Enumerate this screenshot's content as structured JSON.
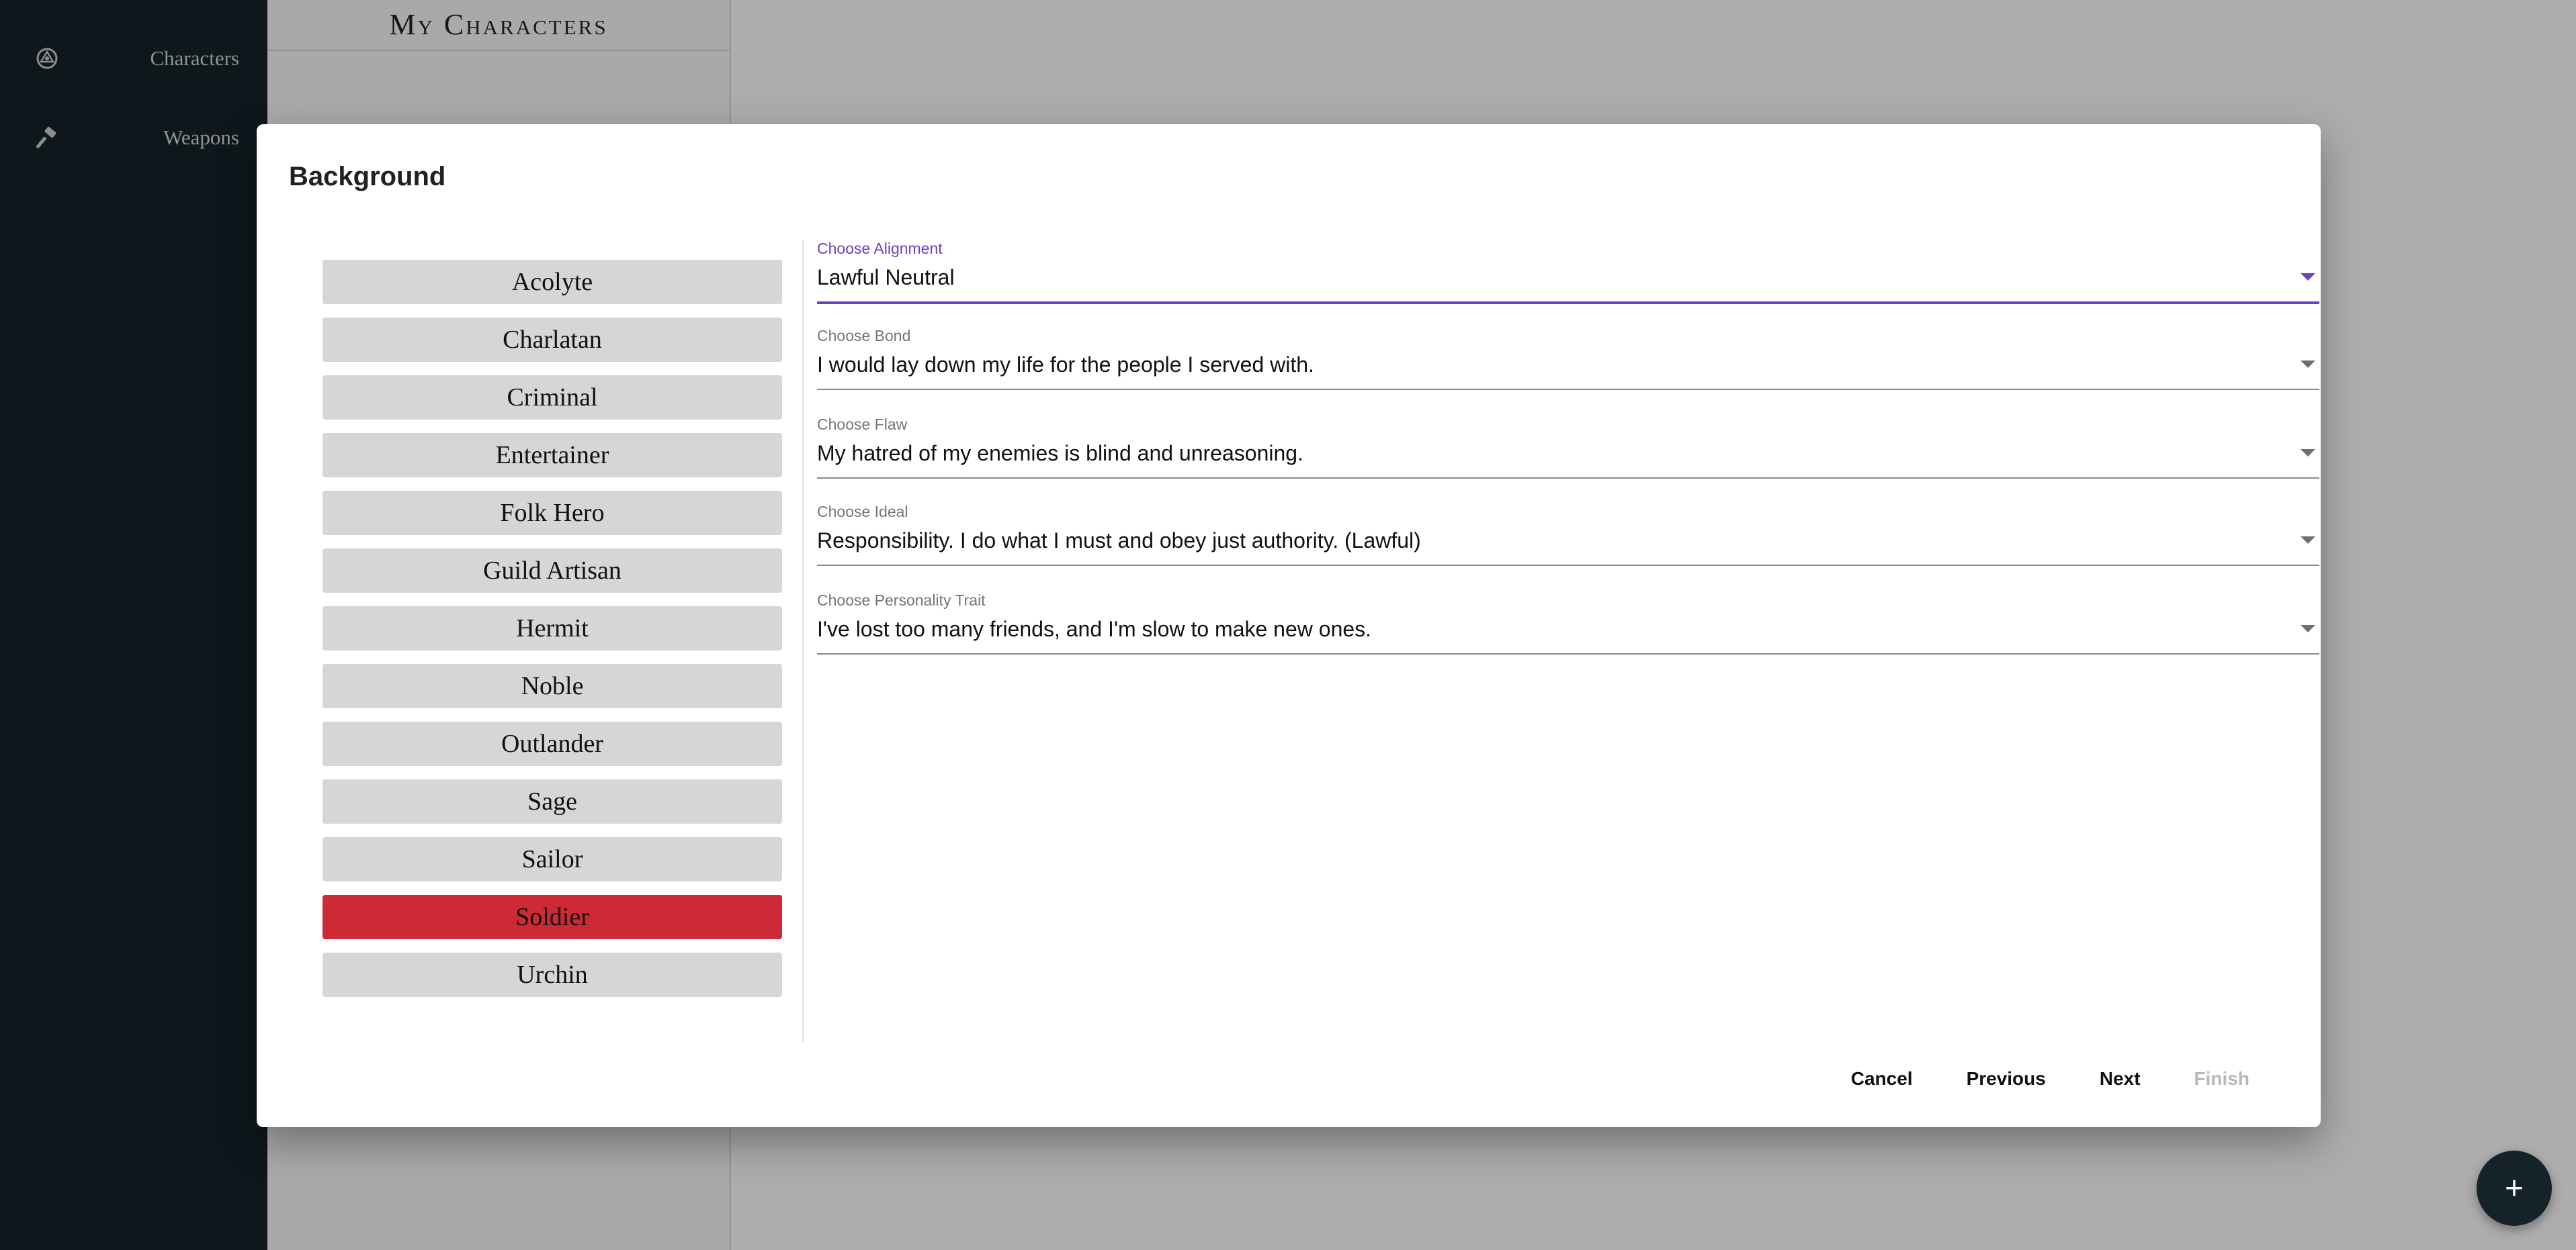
{
  "sidebar": {
    "items": [
      {
        "label": "Characters",
        "icon": "d20-icon"
      },
      {
        "label": "Weapons",
        "icon": "hammer-icon"
      }
    ]
  },
  "main": {
    "title": "My Characters"
  },
  "dialog": {
    "title": "Background",
    "backgrounds": [
      "Acolyte",
      "Charlatan",
      "Criminal",
      "Entertainer",
      "Folk Hero",
      "Guild Artisan",
      "Hermit",
      "Noble",
      "Outlander",
      "Sage",
      "Sailor",
      "Soldier",
      "Urchin"
    ],
    "selected_background": "Soldier",
    "fields": [
      {
        "label": "Choose Alignment",
        "value": "Lawful Neutral"
      },
      {
        "label": "Choose Bond",
        "value": "I would lay down my life for the people I served with."
      },
      {
        "label": "Choose Flaw",
        "value": "My hatred of my enemies is blind and unreasoning."
      },
      {
        "label": "Choose Ideal",
        "value": "Responsibility. I do what I must and obey just authority. (Lawful)"
      },
      {
        "label": "Choose Personality Trait",
        "value": "I've lost too many friends, and I'm slow to make new ones."
      }
    ],
    "actions": {
      "cancel": "Cancel",
      "previous": "Previous",
      "next": "Next",
      "finish": "Finish"
    }
  },
  "fab": {
    "label": "+"
  },
  "colors": {
    "sidebar_bg": "#16222a",
    "accent_purple": "#6a3fc9",
    "selected_red": "#cd2a36",
    "button_gray": "#d6d6d6"
  }
}
